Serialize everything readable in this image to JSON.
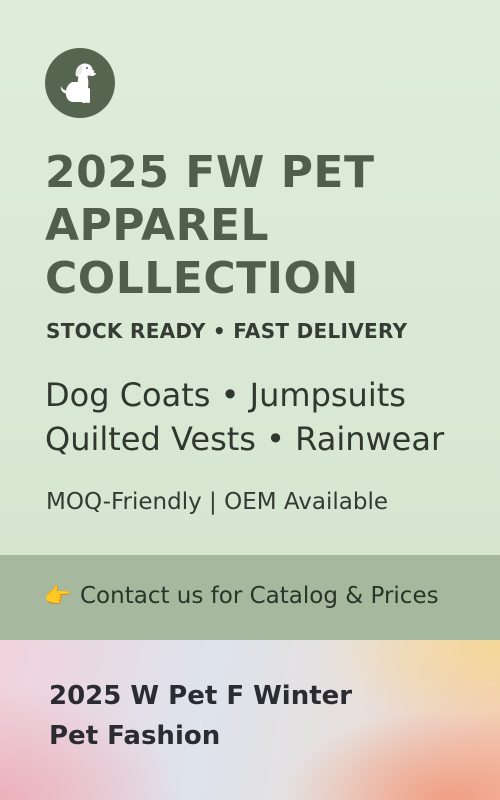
{
  "logo": {
    "icon": "dog-icon"
  },
  "title_lines": [
    "2025 FW PET",
    "APPAREL",
    "COLLECTION"
  ],
  "subtitle": "STOCK READY • FAST DELIVERY",
  "products": [
    "Dog Coats • Jumpsuits",
    "Quilted Vests • Rainwear"
  ],
  "features": "MOQ-Friendly | OEM Available",
  "cta": {
    "icon": "pointing-hand-icon",
    "glyph": "👉",
    "text": "Contact us for Catalog & Prices"
  },
  "footer_title_lines": [
    "2025 W Pet F Winter",
    "Pet Fashion"
  ],
  "colors": {
    "background": "#dcead6",
    "title": "#4f5f4c",
    "logo_circle": "#56654f",
    "cta_band": "#a6b89d"
  }
}
